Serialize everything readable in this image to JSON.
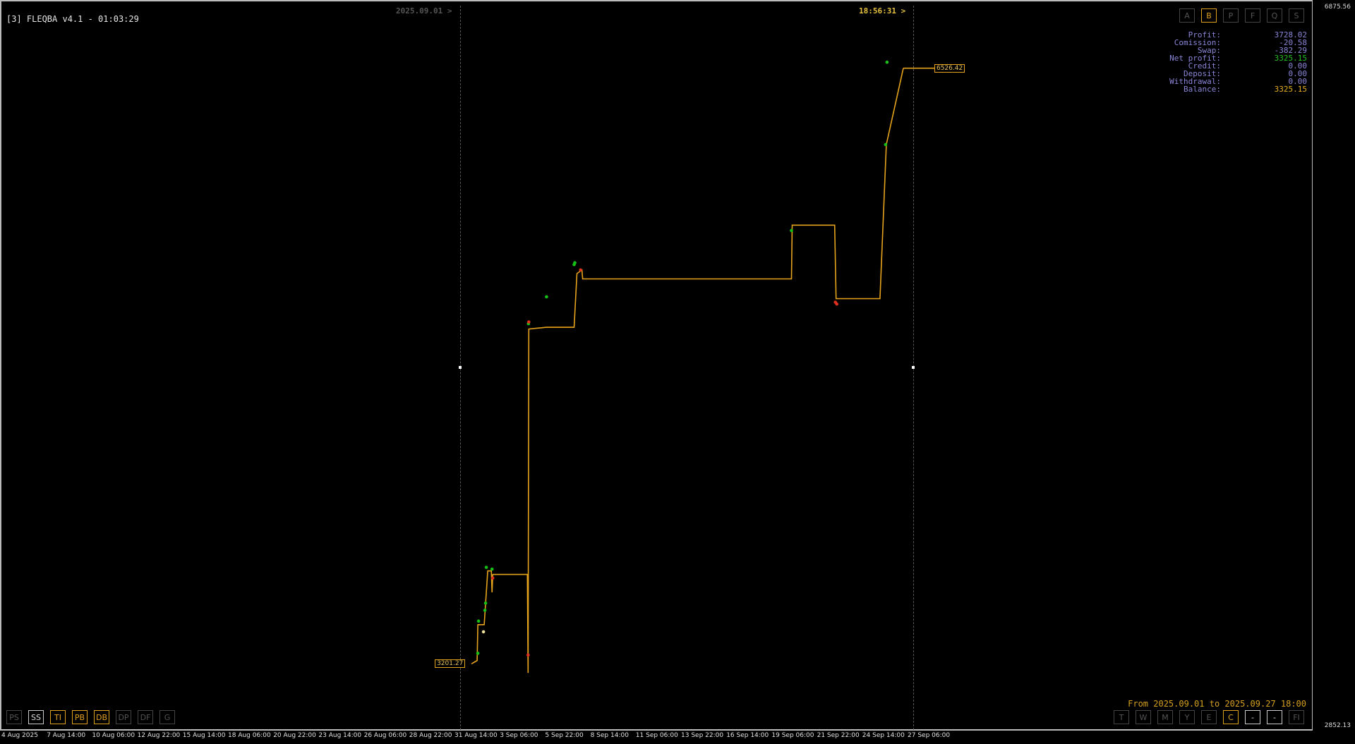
{
  "window": {
    "title": "[3] FLEQBA v4.1 - 01:03:29"
  },
  "markers": {
    "start_label": "2025.09.01 >",
    "end_label": "18:56:31 >"
  },
  "top_buttons": [
    "A",
    "B",
    "P",
    "F",
    "Q",
    "S"
  ],
  "top_active": "B",
  "stats": [
    {
      "label": "Profit:",
      "value": "3728.02",
      "color": "#8a86d8"
    },
    {
      "label": "Comission:",
      "value": "-20.58",
      "color": "#8a86d8"
    },
    {
      "label": "Swap:",
      "value": "-382.29",
      "color": "#8a86d8"
    },
    {
      "label": "Net profit:",
      "value": "3325.15",
      "color": "#22c022"
    },
    {
      "label": "Credit:",
      "value": "0.00",
      "color": "#8a86d8"
    },
    {
      "label": "Deposit:",
      "value": "0.00",
      "color": "#8a86d8"
    },
    {
      "label": "Withdrawal:",
      "value": "0.00",
      "color": "#8a86d8"
    },
    {
      "label": "Balance:",
      "value": "3325.15",
      "color": "#e6b020"
    }
  ],
  "y_axis": {
    "top": "6875.56",
    "bottom": "2852.13"
  },
  "period_text": "From 2025.09.01 to 2025.09.27 18:00",
  "bottom_left_buttons": [
    {
      "label": "PS",
      "state": "off"
    },
    {
      "label": "SS",
      "state": "white"
    },
    {
      "label": "TI",
      "state": "active"
    },
    {
      "label": "PB",
      "state": "active"
    },
    {
      "label": "DB",
      "state": "active"
    },
    {
      "label": "DP",
      "state": "off"
    },
    {
      "label": "DF",
      "state": "off"
    },
    {
      "label": "G",
      "state": "off"
    }
  ],
  "bottom_right_buttons": [
    {
      "label": "T",
      "state": "off"
    },
    {
      "label": "W",
      "state": "off"
    },
    {
      "label": "M",
      "state": "off"
    },
    {
      "label": "Y",
      "state": "off"
    },
    {
      "label": "E",
      "state": "off"
    },
    {
      "label": "C",
      "state": "active"
    },
    {
      "label": "-",
      "state": "white"
    },
    {
      "label": "-",
      "state": "white"
    },
    {
      "label": "FI",
      "state": "off"
    }
  ],
  "x_ticks": [
    "4 Aug 2025",
    "7 Aug 14:00",
    "10 Aug 06:00",
    "12 Aug 22:00",
    "15 Aug 14:00",
    "18 Aug 06:00",
    "20 Aug 22:00",
    "23 Aug 14:00",
    "26 Aug 06:00",
    "28 Aug 22:00",
    "31 Aug 14:00",
    "3 Sep 06:00",
    "5 Sep 22:00",
    "8 Sep 14:00",
    "11 Sep 06:00",
    "13 Sep 22:00",
    "16 Sep 14:00",
    "19 Sep 06:00",
    "21 Sep 22:00",
    "24 Sep 14:00",
    "27 Sep 06:00"
  ],
  "chart_data": {
    "type": "line",
    "title": "",
    "xlabel": "",
    "ylabel": "",
    "ylim": [
      2852.13,
      6875.56
    ],
    "start_value_label": "3201.27",
    "end_value_label": "6526.42",
    "series": [
      {
        "color": "#e6a41c",
        "x": [
          "31 Aug 16:00",
          "1 Sep 00:00",
          "1 Sep 01:00",
          "1 Sep 10:00",
          "1 Sep 11:00",
          "1 Sep 15:00",
          "1 Sep 20:00",
          "1 Sep 21:00",
          "1 Sep 22:00",
          "3 Sep 23:00",
          "4 Sep 00:00",
          "4 Sep 01:00",
          "5 Sep 02:00",
          "5 Sep 02:30",
          "5 Sep 03:00",
          "6 Sep 17:00",
          "6 Sep 21:00",
          "7 Sep 04:00",
          "7 Sep 05:00",
          "19 Sep 12:00",
          "19 Sep 13:00",
          "22 Sep 01:00",
          "22 Sep 03:00",
          "24 Sep 17:00",
          "25 Sep 02:00",
          "26 Sep 02:00"
        ],
        "y": [
          3201.27,
          3220,
          3420,
          3420,
          3480,
          3720,
          3720,
          3600,
          3700,
          3700,
          3150,
          5070,
          5080,
          5080,
          5080,
          5080,
          5380,
          5400,
          5350,
          5350,
          5650,
          5650,
          5240,
          5240,
          6100,
          6526.42
        ]
      }
    ],
    "points": [
      {
        "x": "1 Sep 01:00",
        "y": 3260,
        "color": "green"
      },
      {
        "x": "1 Sep 02:00",
        "y": 3440,
        "color": "green"
      },
      {
        "x": "1 Sep 09:00",
        "y": 3380,
        "color": "white"
      },
      {
        "x": "1 Sep 11:00",
        "y": 3500,
        "color": "green"
      },
      {
        "x": "1 Sep 12:00",
        "y": 3540,
        "color": "green"
      },
      {
        "x": "1 Sep 13:00",
        "y": 3740,
        "color": "green"
      },
      {
        "x": "1 Sep 21:00",
        "y": 3730,
        "color": "green"
      },
      {
        "x": "1 Sep 22:00",
        "y": 3680,
        "color": "red"
      },
      {
        "x": "4 Sep 00:00",
        "y": 3250,
        "color": "red"
      },
      {
        "x": "4 Sep 00:30",
        "y": 5100,
        "color": "green"
      },
      {
        "x": "4 Sep 01:00",
        "y": 5110,
        "color": "red"
      },
      {
        "x": "5 Sep 02:00",
        "y": 5250,
        "color": "green"
      },
      {
        "x": "6 Sep 17:00",
        "y": 5430,
        "color": "green"
      },
      {
        "x": "6 Sep 18:00",
        "y": 5440,
        "color": "green"
      },
      {
        "x": "7 Sep 02:00",
        "y": 5400,
        "color": "red"
      },
      {
        "x": "19 Sep 12:00",
        "y": 5620,
        "color": "green"
      },
      {
        "x": "22 Sep 02:00",
        "y": 5220,
        "color": "red"
      },
      {
        "x": "22 Sep 04:00",
        "y": 5210,
        "color": "red"
      },
      {
        "x": "25 Sep 01:00",
        "y": 6100,
        "color": "green"
      },
      {
        "x": "25 Sep 03:00",
        "y": 6560,
        "color": "green"
      }
    ]
  }
}
